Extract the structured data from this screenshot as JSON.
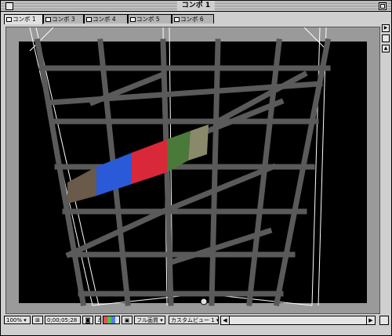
{
  "window": {
    "title": "コンポ 1"
  },
  "tabs": [
    {
      "label": "コンポ 1"
    },
    {
      "label": "コンポ 3"
    },
    {
      "label": "コンポ 4"
    },
    {
      "label": "コンポ 5"
    },
    {
      "label": "コンポ 6"
    }
  ],
  "statusbar": {
    "zoom": "100%",
    "timecode": "0;00;05;28",
    "quality": "フル画質",
    "view": "カスタムビュー 1"
  },
  "colors": {
    "background": "#000000",
    "grid": "#5a5a5a",
    "wire": "#ffffff"
  },
  "icons": [
    "close-box-icon",
    "zoom-box-icon",
    "camera-icon",
    "channel-icon",
    "grid-toggle-icon",
    "dropdown-arrow-icon",
    "scroll-left-icon",
    "scroll-right-icon"
  ]
}
